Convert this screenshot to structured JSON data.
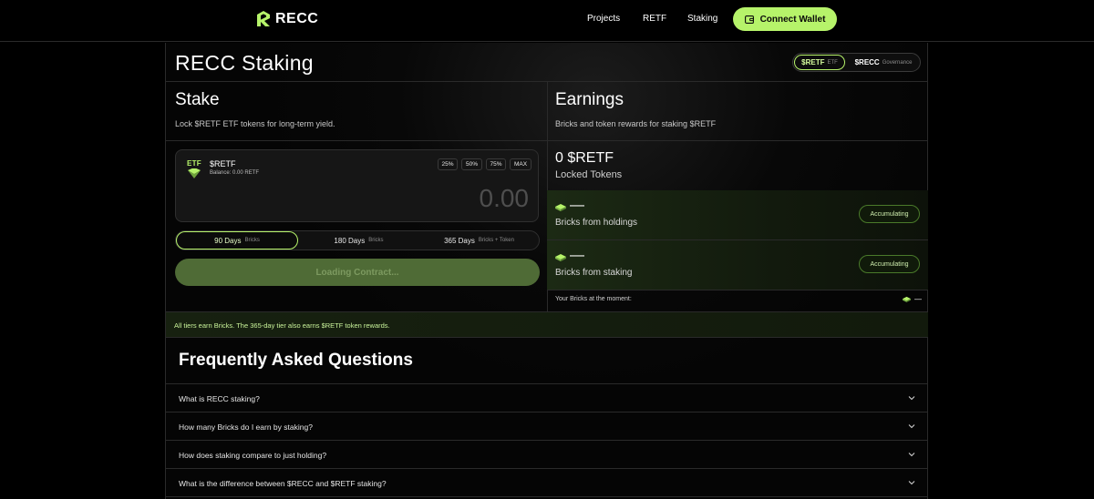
{
  "nav": {
    "brand": "RECC",
    "links": [
      "Projects",
      "RETF",
      "Staking"
    ],
    "connect_label": "Connect Wallet"
  },
  "page": {
    "title": "RECC Staking",
    "toggle": {
      "options": [
        {
          "main": "$RETF",
          "sub": "ETF",
          "active": true
        },
        {
          "main": "$RECC",
          "sub": "Governance",
          "active": false
        }
      ]
    }
  },
  "stake": {
    "title": "Stake",
    "subtitle": "Lock $RETF ETF tokens for long-term yield.",
    "token": {
      "icon_text": "ETF",
      "name": "$RETF",
      "balance": "Balance: 0.00 RETF"
    },
    "percent_buttons": [
      "25%",
      "50%",
      "75%",
      "MAX"
    ],
    "amount_placeholder": "0.00",
    "durations": [
      {
        "main": "90 Days",
        "sub": "Bricks",
        "active": true
      },
      {
        "main": "180 Days",
        "sub": "Bricks",
        "active": false
      },
      {
        "main": "365 Days",
        "sub": "Bricks + Token",
        "active": false
      }
    ],
    "action_label": "Loading Contract..."
  },
  "earnings": {
    "title": "Earnings",
    "subtitle": "Bricks and token rewards for staking $RETF",
    "locked_value": "0 $RETF",
    "locked_label": "Locked Tokens",
    "rows": [
      {
        "value": "—",
        "label": "Bricks from holdings",
        "badge": "Accumulating"
      },
      {
        "value": "—",
        "label": "Bricks from staking",
        "badge": "Accumulating"
      }
    ],
    "moment_label": "Your Bricks at the moment:",
    "moment_value": "—"
  },
  "notice": "All tiers earn Bricks. The 365-day tier also earns $RETF token rewards.",
  "faq": {
    "title": "Frequently Asked Questions",
    "items": [
      "What is RECC staking?",
      "How many Bricks do I earn by staking?",
      "How does staking compare to just holding?",
      "What is the difference between $RECC and $RETF staking?"
    ]
  },
  "colors": {
    "accent": "#b6f36a",
    "background": "#000000",
    "border": "#2a2a2a",
    "earn_row": "#1c2a14"
  }
}
